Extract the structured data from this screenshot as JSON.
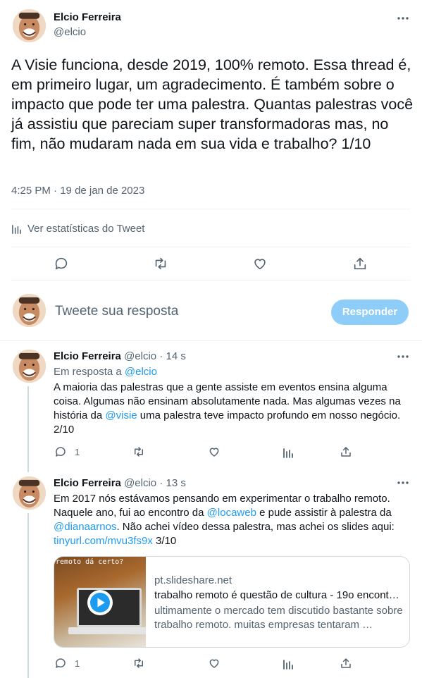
{
  "main_tweet": {
    "author_name": "Elcio Ferreira",
    "author_handle": "@elcio",
    "text": "A Visie funciona, desde 2019, 100% remoto. Essa thread é, em primeiro lugar, um agradecimento. É também sobre o impacto que pode ter uma palestra. Quantas palestras você já assistiu que pareciam super transformadoras mas, no fim, não mudaram nada em sua vida e trabalho? 1/10",
    "time": "4:25 PM",
    "separator": "·",
    "date": "19 de jan de 2023",
    "stats_label": "Ver estatísticas do Tweet"
  },
  "reply_box": {
    "placeholder": "Tweete sua resposta",
    "button_label": "Responder"
  },
  "replies": [
    {
      "author_name": "Elcio Ferreira",
      "author_handle": "@elcio",
      "separator": "·",
      "time_ago": "14 s",
      "reply_prefix": "Em resposta a",
      "reply_to": "@elcio",
      "text_a": "A maioria das palestras que a gente assiste em eventos ensina alguma coisa. Algumas não ensinam absolutamente nada. Mas algumas vezes na história da",
      "mention": "@visie",
      "text_b": "uma palestra teve impacto profundo em nosso negócio. 2/10",
      "reply_count": "1"
    },
    {
      "author_name": "Elcio Ferreira",
      "author_handle": "@elcio",
      "separator": "·",
      "time_ago": "13 s",
      "text_a": "Em 2017 nós estávamos pensando em experimentar o trabalho remoto. Naquele ano, fui ao encontro da",
      "mention_1": "@locaweb",
      "text_b": "e pude assistir à palestra da",
      "mention_2": "@dianaarnos",
      "text_c": ". Não achei vídeo dessa palestra, mas achei os slides aqui:",
      "link": "tinyurl.com/mvu3fs9x",
      "text_d": "3/10",
      "reply_count": "1",
      "card": {
        "domain": "pt.slideshare.net",
        "title": "trabalho remoto é questão de cultura - 19o encont…",
        "description": "ultimamente o mercado tem discutido bastante sobre trabalho remoto. muitas empresas tentaram …",
        "thumb_caption": "remoto dá certo?"
      }
    }
  ],
  "colors": {
    "accent": "#1d9bf0",
    "button_disabled": "#8ecdf8",
    "text": "#0f1419",
    "muted": "#536471",
    "border": "#eff3f4"
  },
  "icons": [
    "more-icon",
    "reply-icon",
    "retweet-icon",
    "like-icon",
    "share-icon",
    "stats-icon",
    "play-icon"
  ]
}
